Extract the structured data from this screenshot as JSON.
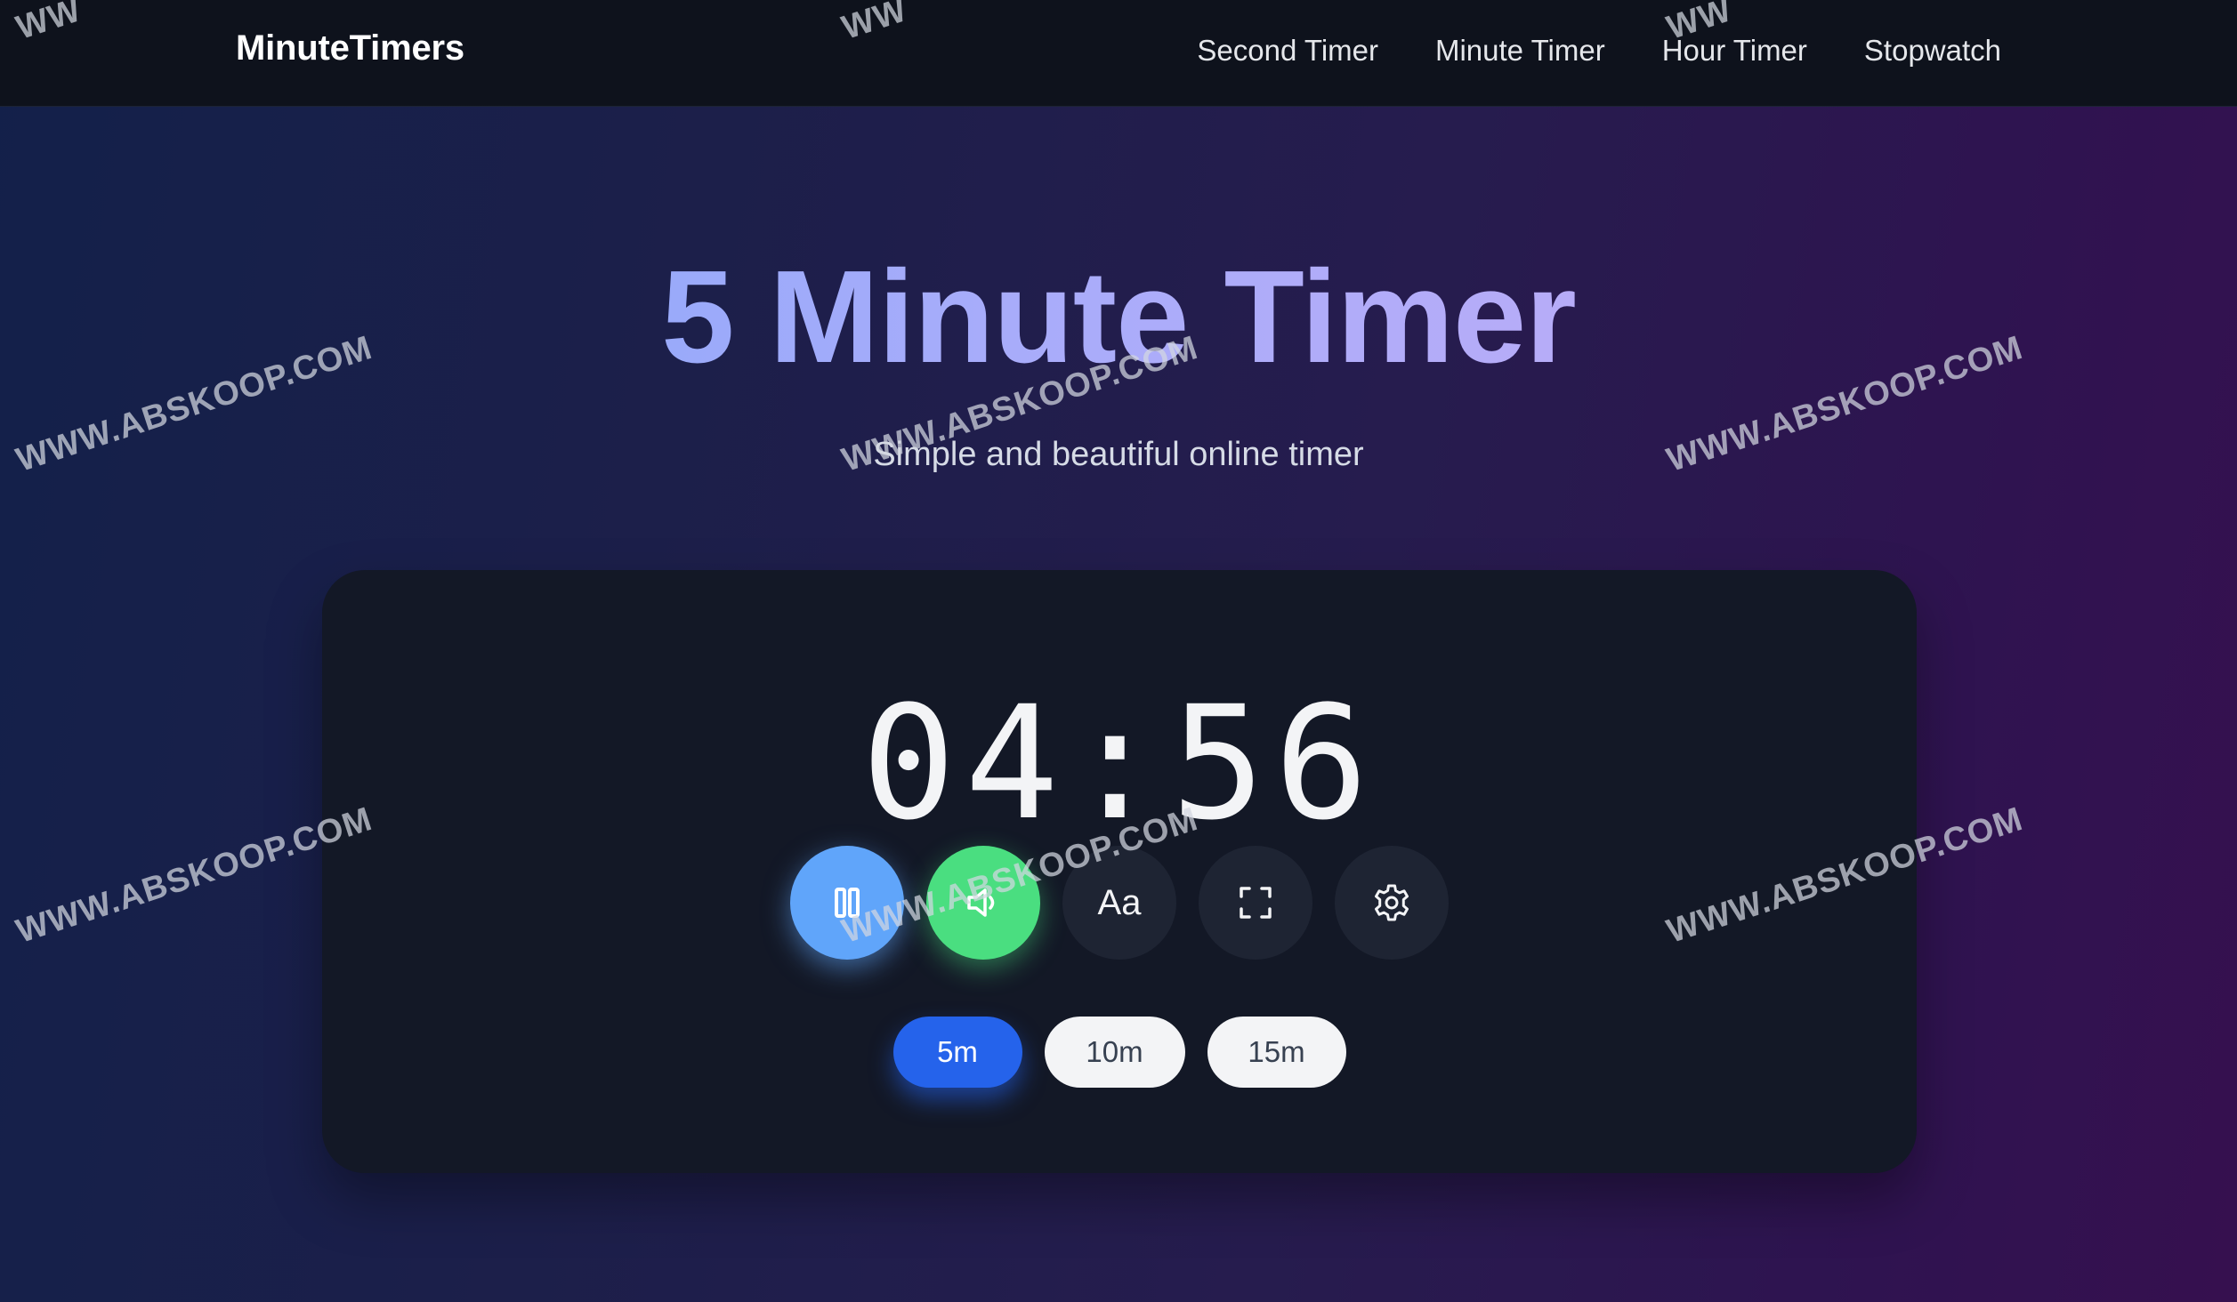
{
  "navbar": {
    "brand": "MinuteTimers",
    "links": [
      {
        "label": "Second Timer"
      },
      {
        "label": "Minute Timer"
      },
      {
        "label": "Hour Timer"
      },
      {
        "label": "Stopwatch"
      }
    ]
  },
  "hero": {
    "title": "5 Minute Timer",
    "subtitle": "Simple and beautiful online timer"
  },
  "timer": {
    "display": "04:56"
  },
  "controls": {
    "pause_icon": "pause-icon",
    "sound_icon": "speaker-icon",
    "font_label": "Aa",
    "fullscreen_icon": "fullscreen-icon",
    "settings_icon": "gear-icon"
  },
  "presets": [
    {
      "label": "5m",
      "active": true
    },
    {
      "label": "10m",
      "active": false
    },
    {
      "label": "15m",
      "active": false
    }
  ],
  "watermark": {
    "text": "WWW.ABSKOOP.COM",
    "partial": "WW"
  },
  "colors": {
    "accent_blue": "#2563eb",
    "pause_blue": "#60a5fa",
    "sound_green": "#4ade80",
    "card_bg": "#131826",
    "nav_bg": "#0e121c"
  }
}
